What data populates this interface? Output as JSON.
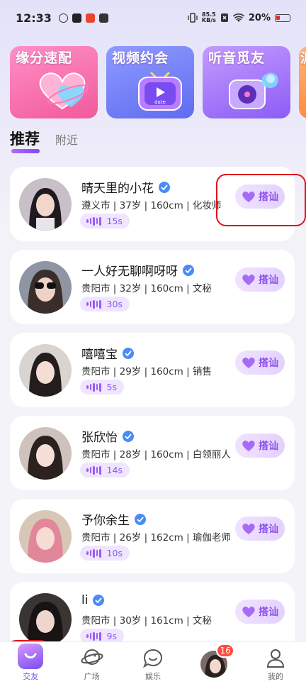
{
  "status_bar": {
    "time": "12:33",
    "net_speed_value": "85.5",
    "net_speed_unit": "KB/s",
    "battery": "20%"
  },
  "banners": [
    {
      "title": "缘分速配",
      "icon": "heart-icon"
    },
    {
      "title": "视频约会",
      "icon": "tv-date-icon"
    },
    {
      "title": "听音觅友",
      "icon": "vinyl-icon"
    },
    {
      "title": "派",
      "icon": "more-icon"
    }
  ],
  "tabs": {
    "active": "推荐",
    "other": "附近"
  },
  "users": [
    {
      "name": "晴天里的小花",
      "info": "遵义市 | 37岁 | 160cm | 化妆师",
      "voice_duration": "15s",
      "greet": "搭讪"
    },
    {
      "name": "一人好无聊啊呀呀",
      "info": "贵阳市 | 32岁 | 160cm | 文秘",
      "voice_duration": "30s",
      "greet": "搭讪"
    },
    {
      "name": "嘻嘻宝",
      "info": "贵阳市 | 29岁 | 160cm | 销售",
      "voice_duration": "5s",
      "greet": "搭讪"
    },
    {
      "name": "张欣怡",
      "info": "贵阳市 | 28岁 | 160cm | 白领丽人",
      "voice_duration": "14s",
      "greet": "搭讪"
    },
    {
      "name": "予你余生",
      "info": "贵阳市 | 26岁 | 162cm | 瑜伽老师",
      "voice_duration": "10s",
      "greet": "搭讪"
    },
    {
      "name": "li",
      "info": "贵阳市 | 30岁 | 161cm | 文秘",
      "voice_duration": "9s",
      "greet": "搭讪"
    }
  ],
  "bottom_nav": {
    "items": [
      {
        "label": "交友",
        "icon": "friends-home-icon"
      },
      {
        "label": "广场",
        "icon": "planet-icon"
      },
      {
        "label": "娱乐",
        "icon": "chat-bubble-icon"
      },
      {
        "label": "",
        "icon": "messages-avatar-icon"
      },
      {
        "label": "我的",
        "icon": "person-icon"
      }
    ],
    "badge": "16"
  },
  "colors": {
    "accent": "#7a4cf0",
    "greet_text": "#8a4ee8",
    "verify": "#4a8cf7",
    "badge": "#ff4a3f",
    "highlight": "#e0141d"
  }
}
